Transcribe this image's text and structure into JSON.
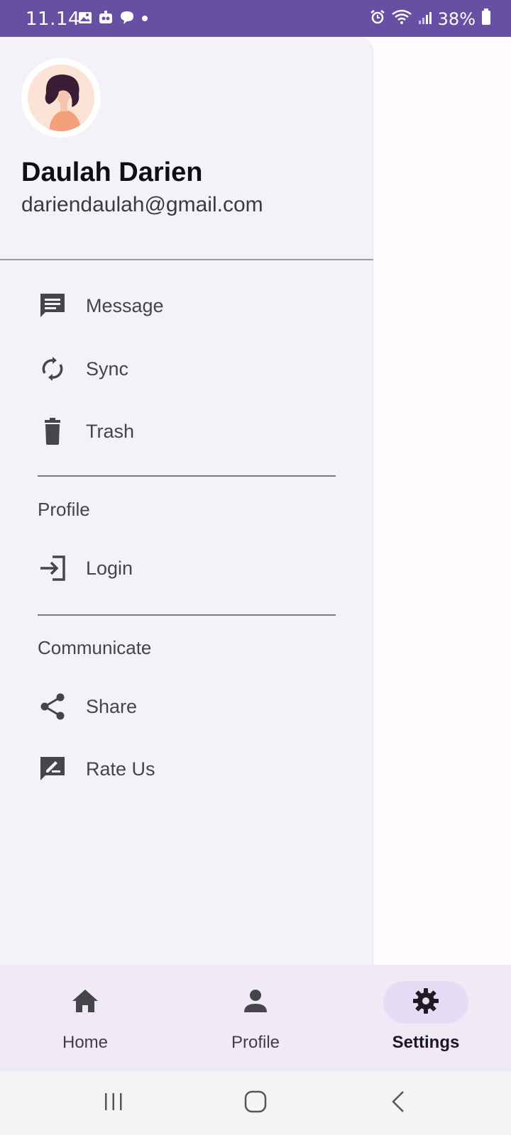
{
  "status_bar": {
    "time": "11.14",
    "battery": "38%",
    "background_color": "#6750a4"
  },
  "drawer": {
    "user": {
      "name": "Daulah Darien",
      "email": "dariendaulah@gmail.com",
      "avatar_icon": "avatar-woman-illustration"
    },
    "items": [
      {
        "label": "Message",
        "icon": "message-icon"
      },
      {
        "label": "Sync",
        "icon": "sync-icon"
      },
      {
        "label": "Trash",
        "icon": "trash-icon"
      }
    ],
    "sections": [
      {
        "title": "Profile",
        "items": [
          {
            "label": "Login",
            "icon": "login-icon"
          }
        ]
      },
      {
        "title": "Communicate",
        "items": [
          {
            "label": "Share",
            "icon": "share-icon"
          },
          {
            "label": "Rate Us",
            "icon": "rate-icon"
          }
        ]
      }
    ]
  },
  "bottom_nav": {
    "items": [
      {
        "label": "Home",
        "icon": "home-icon",
        "active": false
      },
      {
        "label": "Profile",
        "icon": "person-icon",
        "active": false
      },
      {
        "label": "Settings",
        "icon": "gear-icon",
        "active": true
      }
    ],
    "accent_color": "#e6dcf5"
  },
  "system_nav": {
    "buttons": [
      "recents-button",
      "home-button",
      "back-button"
    ]
  }
}
